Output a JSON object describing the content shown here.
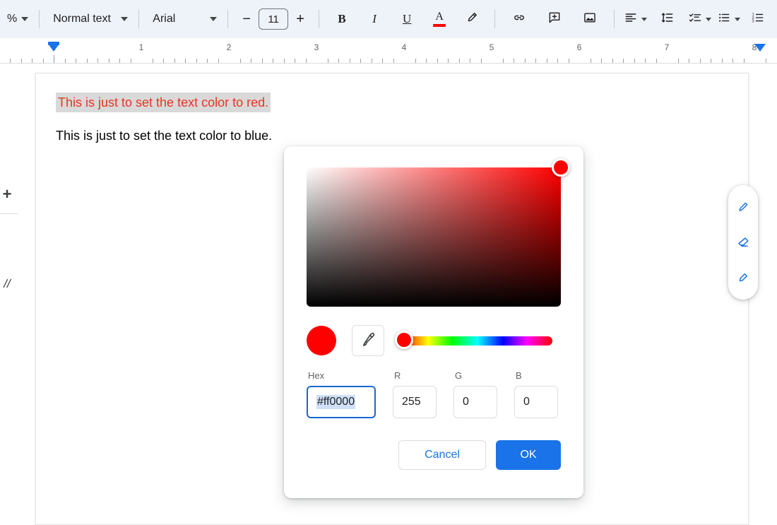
{
  "toolbar": {
    "zoom_value": "%",
    "paragraph_style": "Normal text",
    "font_family": "Arial",
    "decrease_font_label": "−",
    "font_size": "11",
    "increase_font_label": "+",
    "bold_label": "B",
    "italic_label": "I",
    "underline_label": "U",
    "text_color_label": "A",
    "text_color_swatch": "#ff0000",
    "highlight_icon": "highlight-pen-icon",
    "link_icon": "link-icon",
    "comment_icon": "add-comment-icon",
    "image_icon": "insert-image-icon",
    "align_icon": "align-left-icon",
    "line_spacing_icon": "line-spacing-icon",
    "checklist_icon": "checklist-icon",
    "bulleted_list_icon": "bulleted-list-icon",
    "numbered_list_icon": "numbered-list-icon"
  },
  "ruler": {
    "numbers": [
      "1",
      "2",
      "3",
      "4",
      "5",
      "6",
      "7",
      "8"
    ],
    "left_indent_position": "0",
    "right_indent_position": "8"
  },
  "left_rail": {
    "add_label": "+",
    "slashes_label": "//"
  },
  "document": {
    "lines": [
      {
        "text": "This is just to set the text color to red.",
        "color": "#ea3323",
        "selected": true
      },
      {
        "text": "This is just to set the text color to blue.",
        "color": "#000000",
        "selected": false
      }
    ]
  },
  "side_toolbar": {
    "icons": [
      "pen-icon",
      "eraser-icon",
      "marker-icon"
    ],
    "accent": "#1a73e8"
  },
  "color_dialog": {
    "selected_color": "#ff0000",
    "gradient_base_hue": "#ff0000",
    "hex": {
      "label": "Hex",
      "value": "#ff0000",
      "selected": true,
      "focused": true
    },
    "r": {
      "label": "R",
      "value": "255"
    },
    "g": {
      "label": "G",
      "value": "0"
    },
    "b": {
      "label": "B",
      "value": "0"
    },
    "eyedropper_icon": "eyedropper-icon",
    "cancel_label": "Cancel",
    "ok_label": "OK",
    "ok_color": "#1a73e8",
    "cancel_color": "#1a73e8"
  }
}
